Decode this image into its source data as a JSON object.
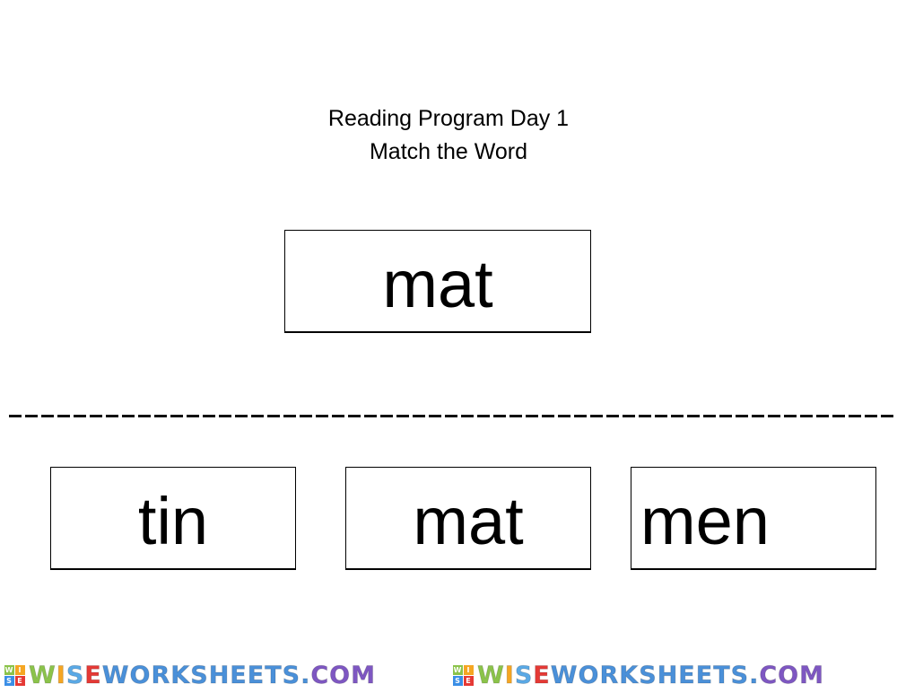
{
  "header": {
    "line1": "Reading Program Day 1",
    "line2": "Match the Word"
  },
  "target_word": "mat",
  "choices": [
    {
      "label": "tin"
    },
    {
      "label": "mat"
    },
    {
      "label": "men"
    }
  ],
  "footer": {
    "logo_text": "WISEWORKSHEETS.COM",
    "logo_block": [
      "W",
      "I",
      "S",
      "E"
    ],
    "colors": {
      "block": [
        "#8bc34a",
        "#f5a623",
        "#3a8ee6",
        "#e53935"
      ],
      "letters": [
        "#8bc34a",
        "#f5a623",
        "#5aa9e6",
        "#e53935",
        "#4a90d9",
        "#4a90d9",
        "#4a90d9",
        "#4a90d9",
        "#4a90d9",
        "#4a90d9",
        "#4a90d9",
        "#4a90d9",
        "#4a90d9",
        "#4a90d9",
        "#4a90d9",
        "#7e57c2",
        "#7e57c2",
        "#7e57c2"
      ]
    }
  }
}
